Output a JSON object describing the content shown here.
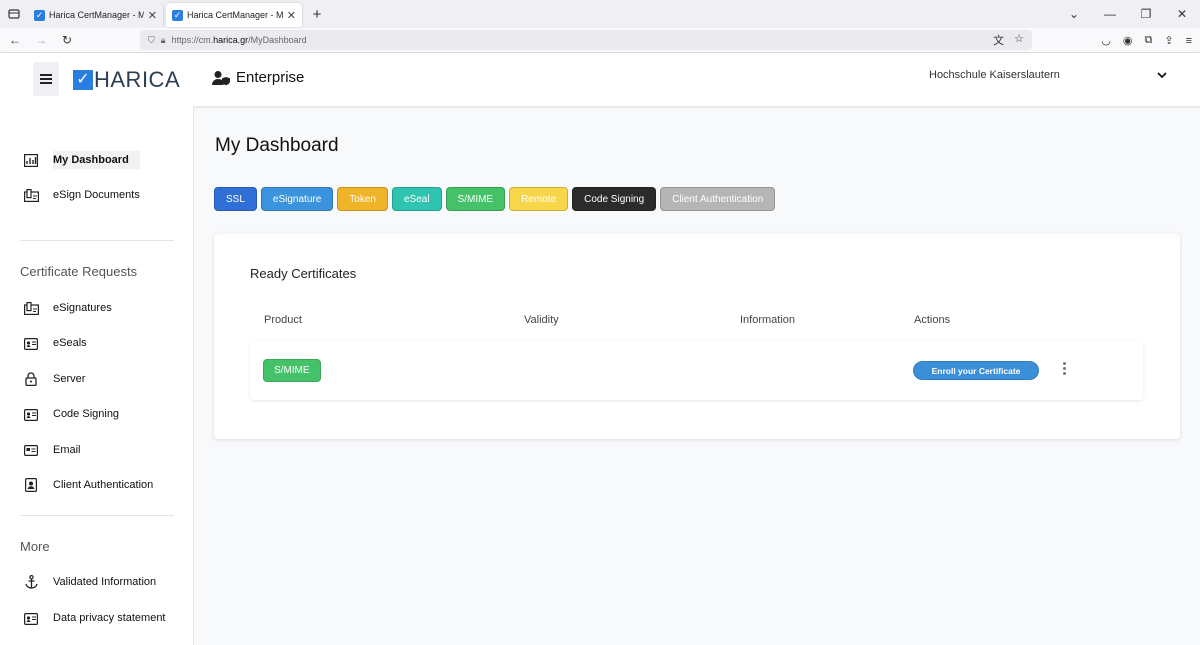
{
  "browser": {
    "tabs": [
      {
        "title": "Harica CertManager - My Dashb",
        "active": false
      },
      {
        "title": "Harica CertManager - My Dashb",
        "active": true
      }
    ],
    "url_prefix": "https://cm.",
    "url_host": "harica.gr",
    "url_path": "/MyDashboard"
  },
  "header": {
    "logo_text": "HARICA",
    "product": "Enterprise",
    "organization": "Hochschule Kaiserslautern"
  },
  "sidebar": {
    "top_items": [
      {
        "label": "My Dashboard",
        "icon": "dashboard-icon",
        "active": true
      },
      {
        "label": "eSign Documents",
        "icon": "document-sign-icon",
        "active": false
      }
    ],
    "section_requests": "Certificate Requests",
    "request_items": [
      {
        "label": "eSignatures",
        "icon": "signature-icon"
      },
      {
        "label": "eSeals",
        "icon": "seal-icon"
      },
      {
        "label": "Server",
        "icon": "lock-icon"
      },
      {
        "label": "Code Signing",
        "icon": "code-card-icon"
      },
      {
        "label": "Email",
        "icon": "email-card-icon"
      },
      {
        "label": "Client Authentication",
        "icon": "client-badge-icon"
      }
    ],
    "section_more": "More",
    "more_items": [
      {
        "label": "Validated Information",
        "icon": "anchor-icon"
      },
      {
        "label": "Data privacy statement",
        "icon": "privacy-card-icon"
      }
    ]
  },
  "main": {
    "title": "My Dashboard",
    "filters": [
      {
        "label": "SSL",
        "color": "#2f6fd6",
        "text": "#ffffff"
      },
      {
        "label": "eSignature",
        "color": "#3a93dc",
        "text": "#ffffff"
      },
      {
        "label": "Token",
        "color": "#f0b429",
        "text": "#ffffff"
      },
      {
        "label": "eSeal",
        "color": "#2ec4b0",
        "text": "#ffffff"
      },
      {
        "label": "S/MIME",
        "color": "#45c16a",
        "text": "#ffffff"
      },
      {
        "label": "Remote",
        "color": "#f7d64a",
        "text": "#ffffff"
      },
      {
        "label": "Code Signing",
        "color": "#2b2b2b",
        "text": "#ffffff"
      },
      {
        "label": "Client Authentication",
        "color": "#b5b5b5",
        "text": "#ffffff"
      }
    ],
    "card_title": "Ready Certificates",
    "columns": [
      "Product",
      "Validity",
      "Information",
      "Actions"
    ],
    "rows": [
      {
        "product": "S/MIME",
        "validity": "",
        "information": "",
        "action": "Enroll your Certificate"
      }
    ]
  }
}
